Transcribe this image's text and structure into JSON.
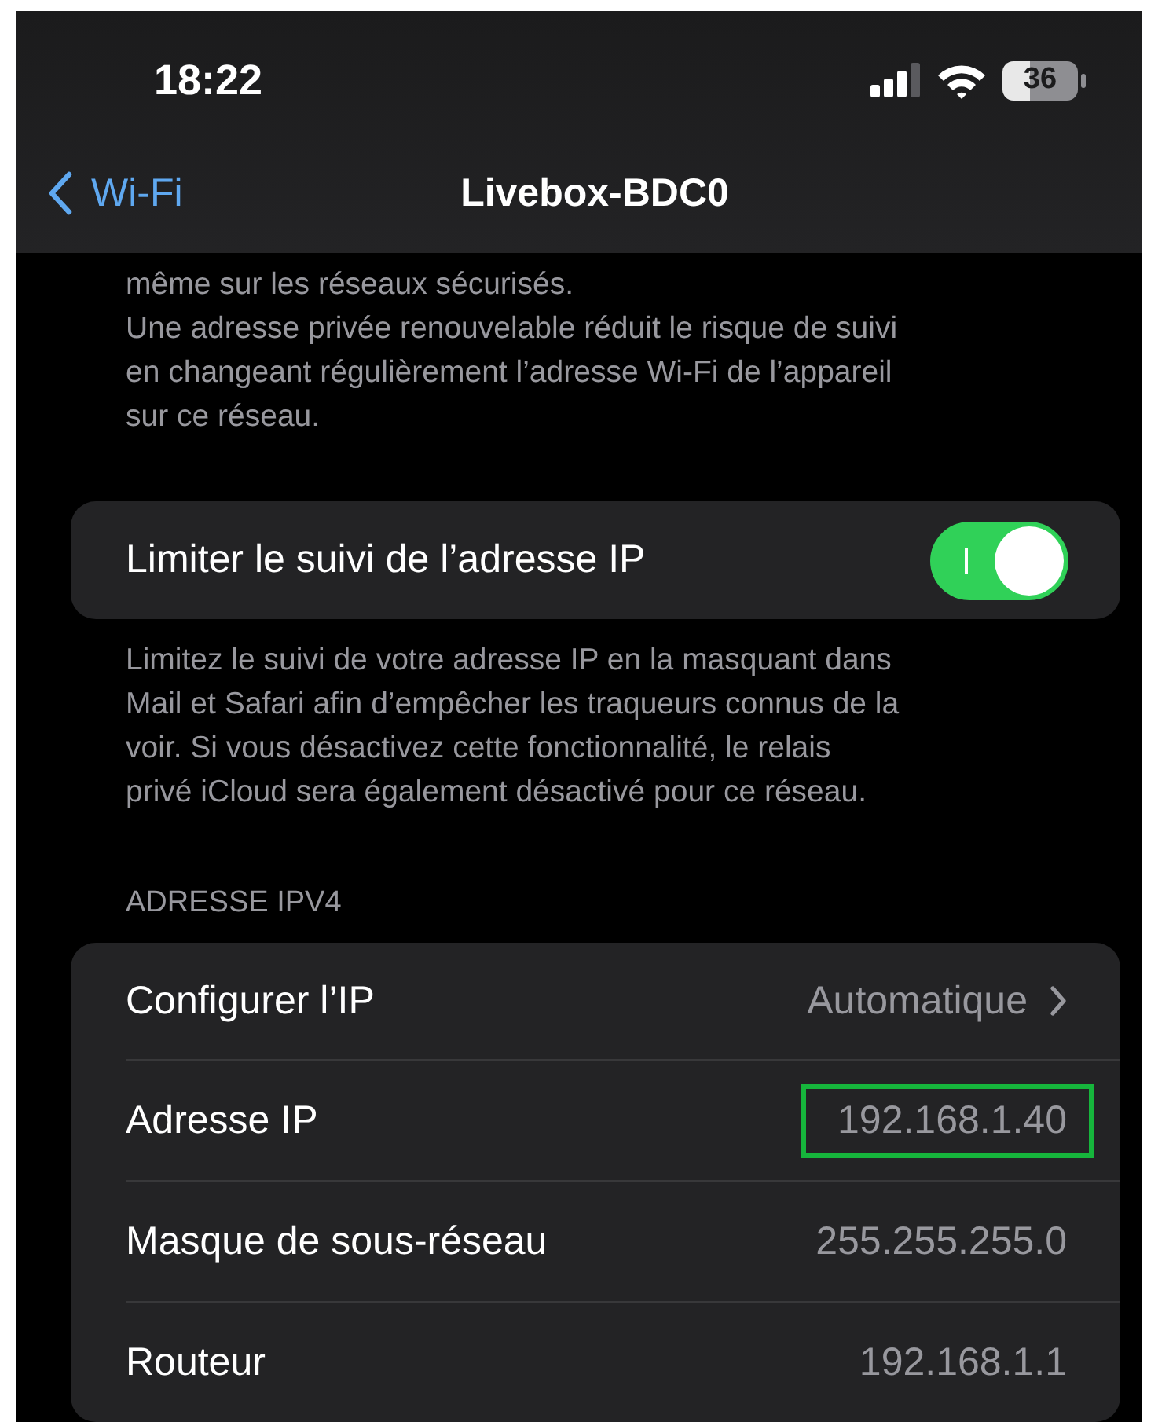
{
  "status_bar": {
    "time": "18:22",
    "battery": "36"
  },
  "nav": {
    "back": "Wi-Fi",
    "title": "Livebox-BDC0"
  },
  "top_note": {
    "lines": [
      "même sur les réseaux sécurisés.",
      "Une adresse privée renouvelable réduit le risque de suivi",
      "en changeant régulièrement l’adresse Wi-Fi de l’appareil",
      "sur ce réseau."
    ]
  },
  "privacy": {
    "label": "Limiter le suivi de l’adresse IP",
    "on": true
  },
  "privacy_note": {
    "lines": [
      "Limitez le suivi de votre adresse IP en la masquant dans",
      "Mail et Safari afin d’empêcher les traqueurs connus de la",
      "voir. Si vous désactivez cette fonctionnalité, le relais",
      "privé iCloud sera également désactivé pour ce réseau."
    ]
  },
  "ipv4": {
    "header": "ADRESSE IPV4",
    "rows": [
      {
        "label": "Configurer l’IP",
        "value": "Automatique",
        "kind": "link",
        "highlighted": false
      },
      {
        "label": "Adresse IP",
        "value": "192.168.1.40",
        "kind": "value",
        "highlighted": true
      },
      {
        "label": "Masque de sous-réseau",
        "value": "255.255.255.0",
        "kind": "value",
        "highlighted": false
      },
      {
        "label": "Routeur",
        "value": "192.168.1.1",
        "kind": "value",
        "highlighted": false
      }
    ]
  }
}
